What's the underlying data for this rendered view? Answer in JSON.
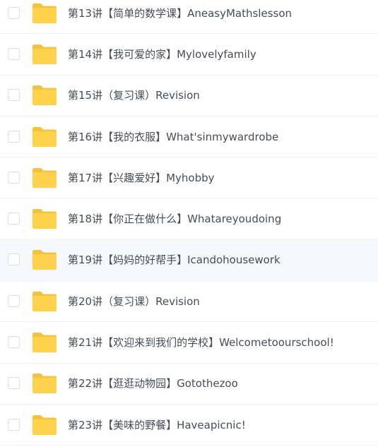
{
  "files": [
    {
      "name": "第13讲【简单的数学课】AneasyMathslesson"
    },
    {
      "name": "第14讲【我可爱的家】Mylovelyfamily"
    },
    {
      "name": "第15讲（复习课）Revision"
    },
    {
      "name": "第16讲【我的衣服】What'sinmywardrobe"
    },
    {
      "name": "第17讲【兴趣爱好】Myhobby"
    },
    {
      "name": "第18讲【你正在做什么】Whatareyoudoing"
    },
    {
      "name": "第19讲【妈妈的好帮手】Icandohousework"
    },
    {
      "name": "第20讲（复习课）Revision"
    },
    {
      "name": "第21讲【欢迎来到我们的学校】Welcometoourschool!"
    },
    {
      "name": "第22讲【逛逛动物园】Gotothezoo"
    },
    {
      "name": "第23讲【美味的野餐】Haveapicnic!"
    }
  ],
  "colors": {
    "folder": "#ffd24d",
    "folder_tab": "#f6c23e",
    "text": "#454d5a",
    "hover_row": "#f5f8fd"
  }
}
